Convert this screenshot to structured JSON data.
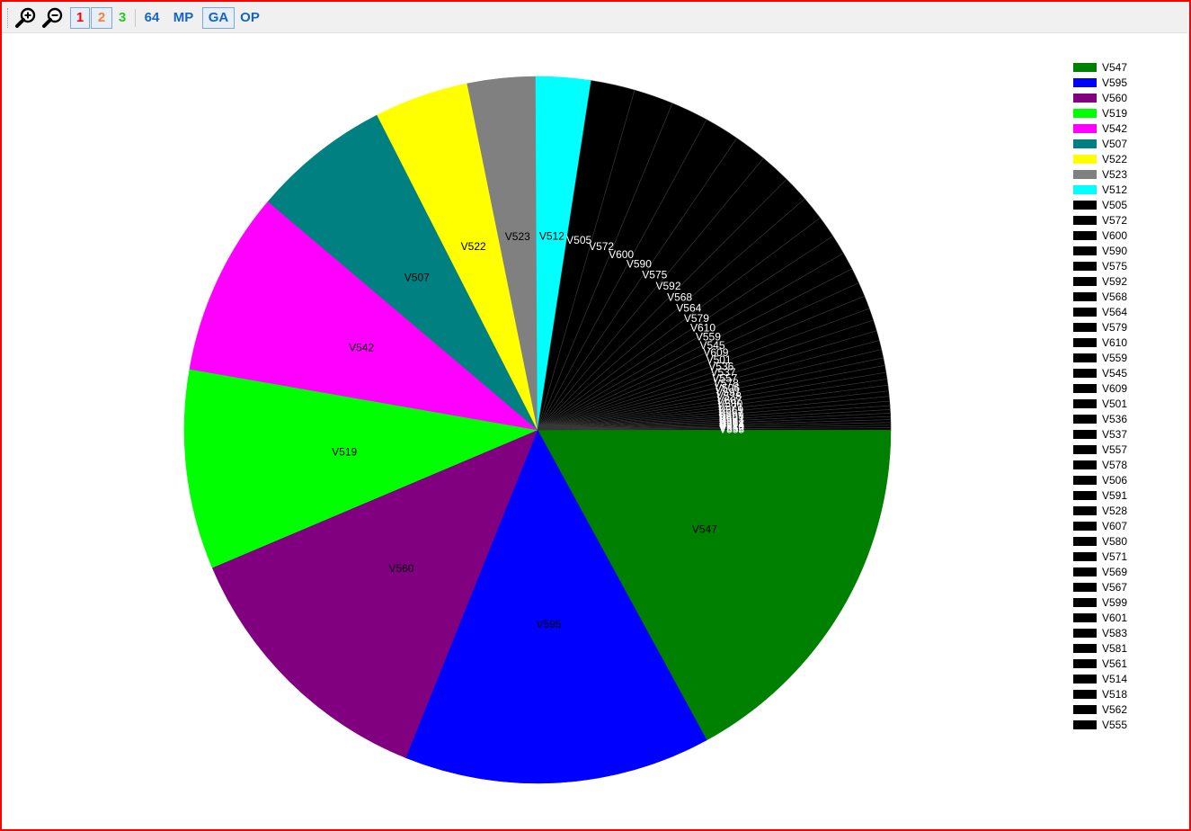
{
  "toolbar": {
    "zoom_in_icon": "zoom-in-icon",
    "zoom_out_icon": "zoom-out-icon",
    "btn1": {
      "label": "1",
      "color": "#ff0000"
    },
    "btn2": {
      "label": "2",
      "color": "#ff7f27"
    },
    "btn3": {
      "label": "3",
      "color": "#22cc22"
    },
    "btn64": {
      "label": "64",
      "color": "#1565c0"
    },
    "btnMP": {
      "label": "MP",
      "color": "#1565c0"
    },
    "btnGA": {
      "label": "GA",
      "color": "#1565c0"
    },
    "btnOP": {
      "label": "OP",
      "color": "#1565c0"
    }
  },
  "chart_data": {
    "type": "pie",
    "legend_position": "right",
    "start": "3 o'clock, clockwise",
    "slices": [
      {
        "label": "V547",
        "value": 17.0,
        "color": "#008000",
        "label_color": "#000000"
      },
      {
        "label": "V595",
        "value": 14.0,
        "color": "#0000ff",
        "label_color": "#000000"
      },
      {
        "label": "V560",
        "value": 12.5,
        "color": "#800080",
        "label_color": "#000000"
      },
      {
        "label": "V519",
        "value": 9.1,
        "color": "#00ff00",
        "label_color": "#000000"
      },
      {
        "label": "V542",
        "value": 8.4,
        "color": "#ff00ff",
        "label_color": "#000000"
      },
      {
        "label": "V507",
        "value": 6.3,
        "color": "#008080",
        "label_color": "#000000"
      },
      {
        "label": "V522",
        "value": 4.3,
        "color": "#ffff00",
        "label_color": "#000000"
      },
      {
        "label": "V523",
        "value": 3.1,
        "color": "#808080",
        "label_color": "#000000"
      },
      {
        "label": "V512",
        "value": 2.5,
        "color": "#00ffff",
        "label_color": "#000000"
      },
      {
        "label": "V505",
        "value": 2.0,
        "color": "#000000",
        "label_color": "#ffffff"
      },
      {
        "label": "V572",
        "value": 1.8,
        "color": "#000000",
        "label_color": "#ffffff"
      },
      {
        "label": "V600",
        "value": 1.7,
        "color": "#000000",
        "label_color": "#ffffff"
      },
      {
        "label": "V590",
        "value": 1.6,
        "color": "#000000",
        "label_color": "#ffffff"
      },
      {
        "label": "V575",
        "value": 1.5,
        "color": "#000000",
        "label_color": "#ffffff"
      },
      {
        "label": "V592",
        "value": 1.4,
        "color": "#000000",
        "label_color": "#ffffff"
      },
      {
        "label": "V568",
        "value": 1.2,
        "color": "#000000",
        "label_color": "#ffffff"
      },
      {
        "label": "V564",
        "value": 1.1,
        "color": "#000000",
        "label_color": "#ffffff"
      },
      {
        "label": "V579",
        "value": 1.0,
        "color": "#000000",
        "label_color": "#ffffff"
      },
      {
        "label": "V610",
        "value": 0.9,
        "color": "#000000",
        "label_color": "#ffffff"
      },
      {
        "label": "V559",
        "value": 0.8,
        "color": "#000000",
        "label_color": "#ffffff"
      },
      {
        "label": "V545",
        "value": 0.7,
        "color": "#000000",
        "label_color": "#ffffff"
      },
      {
        "label": "V609",
        "value": 0.65,
        "color": "#000000",
        "label_color": "#ffffff"
      },
      {
        "label": "V501",
        "value": 0.6,
        "color": "#000000",
        "label_color": "#ffffff"
      },
      {
        "label": "V536",
        "value": 0.55,
        "color": "#000000",
        "label_color": "#ffffff"
      },
      {
        "label": "V537",
        "value": 0.5,
        "color": "#000000",
        "label_color": "#ffffff"
      },
      {
        "label": "V557",
        "value": 0.45,
        "color": "#000000",
        "label_color": "#ffffff"
      },
      {
        "label": "V578",
        "value": 0.42,
        "color": "#000000",
        "label_color": "#ffffff"
      },
      {
        "label": "V506",
        "value": 0.38,
        "color": "#000000",
        "label_color": "#ffffff"
      },
      {
        "label": "V591",
        "value": 0.35,
        "color": "#000000",
        "label_color": "#ffffff"
      },
      {
        "label": "V528",
        "value": 0.32,
        "color": "#000000",
        "label_color": "#ffffff"
      },
      {
        "label": "V607",
        "value": 0.3,
        "color": "#000000",
        "label_color": "#ffffff"
      },
      {
        "label": "V580",
        "value": 0.28,
        "color": "#000000",
        "label_color": "#ffffff"
      },
      {
        "label": "V571",
        "value": 0.26,
        "color": "#000000",
        "label_color": "#ffffff"
      },
      {
        "label": "V569",
        "value": 0.24,
        "color": "#000000",
        "label_color": "#ffffff"
      },
      {
        "label": "V567",
        "value": 0.22,
        "color": "#000000",
        "label_color": "#ffffff"
      },
      {
        "label": "V599",
        "value": 0.2,
        "color": "#000000",
        "label_color": "#ffffff"
      },
      {
        "label": "V601",
        "value": 0.18,
        "color": "#000000",
        "label_color": "#ffffff"
      },
      {
        "label": "V583",
        "value": 0.16,
        "color": "#000000",
        "label_color": "#ffffff"
      },
      {
        "label": "V581",
        "value": 0.15,
        "color": "#000000",
        "label_color": "#ffffff"
      },
      {
        "label": "V561",
        "value": 0.14,
        "color": "#000000",
        "label_color": "#ffffff"
      },
      {
        "label": "V514",
        "value": 0.13,
        "color": "#000000",
        "label_color": "#ffffff"
      },
      {
        "label": "V518",
        "value": 0.12,
        "color": "#000000",
        "label_color": "#ffffff"
      },
      {
        "label": "V562",
        "value": 0.11,
        "color": "#000000",
        "label_color": "#ffffff"
      },
      {
        "label": "V555",
        "value": 0.1,
        "color": "#000000",
        "label_color": "#ffffff"
      }
    ]
  }
}
